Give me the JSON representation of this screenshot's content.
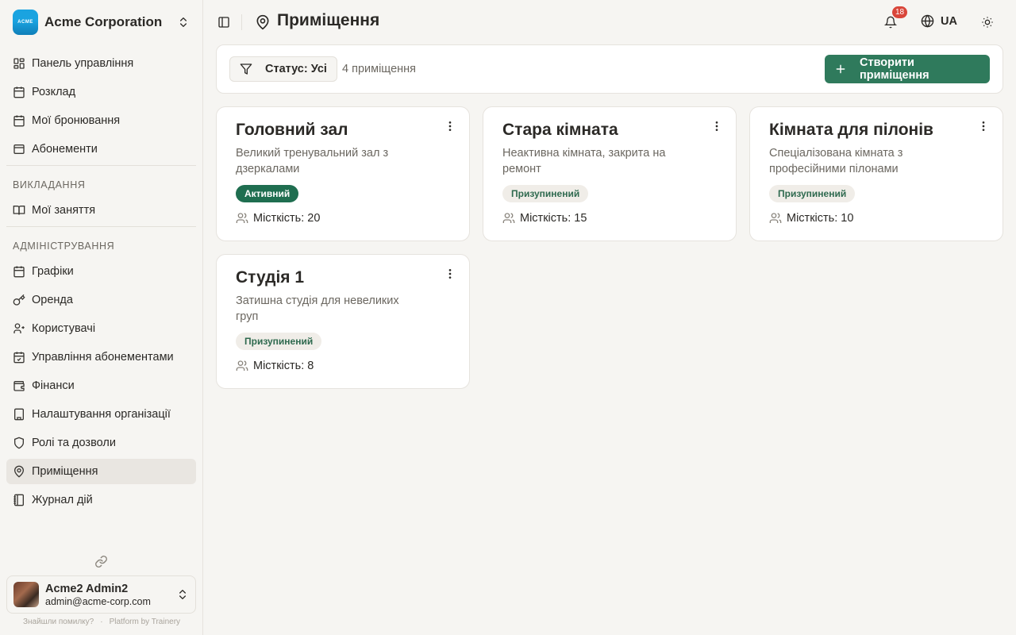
{
  "org": {
    "name": "Acme Corporation",
    "logo_text": "ACME"
  },
  "sidebar": {
    "main": [
      {
        "label": "Панель управління",
        "icon": "layout-dashboard-icon"
      },
      {
        "label": "Розклад",
        "icon": "calendar-icon"
      },
      {
        "label": "Мої бронювання",
        "icon": "calendar-check-icon"
      },
      {
        "label": "Абонементи",
        "icon": "ticket-icon"
      }
    ],
    "teaching_heading": "Викладання",
    "teaching": [
      {
        "label": "Мої заняття",
        "icon": "book-open-icon"
      }
    ],
    "admin_heading": "Адміністрування",
    "admin": [
      {
        "label": "Графіки",
        "icon": "calendar-days-icon"
      },
      {
        "label": "Оренда",
        "icon": "key-icon"
      },
      {
        "label": "Користувачі",
        "icon": "users-icon"
      },
      {
        "label": "Управління абонементами",
        "icon": "list-checks-icon"
      },
      {
        "label": "Фінанси",
        "icon": "wallet-icon"
      },
      {
        "label": "Налаштування організації",
        "icon": "building-icon"
      },
      {
        "label": "Ролі та дозволи",
        "icon": "shield-icon"
      },
      {
        "label": "Приміщення",
        "icon": "map-pin-icon"
      },
      {
        "label": "Журнал дій",
        "icon": "notebook-icon"
      }
    ]
  },
  "user": {
    "name": "Acme2 Admin2",
    "email": "admin@acme-corp.com"
  },
  "footer": {
    "report": "Знайшли помилку?",
    "separator": "·",
    "platform": "Platform by Trainery"
  },
  "header": {
    "title": "Приміщення",
    "notifications": "18",
    "language": "UA"
  },
  "toolbar": {
    "filter_label": "Статус: Усі",
    "count_label": "4 приміщення",
    "create_label": "Створити приміщення"
  },
  "rooms": [
    {
      "name": "Головний зал",
      "description": "Великий тренувальний зал з дзеркалами",
      "status": "Активний",
      "capacity": "Місткість: 20"
    },
    {
      "name": "Стара кімната",
      "description": "Неактивна кімната, закрита на ремонт",
      "status": "Призупинений",
      "capacity": "Місткість: 15"
    },
    {
      "name": "Кімната для пілонів",
      "description": "Спеціалізована кімната з професійними пілонами",
      "status": "Призупинений",
      "capacity": "Місткість: 10"
    },
    {
      "name": "Студія 1",
      "description": "Затишна студія для невеликих груп",
      "status": "Призупинений",
      "capacity": "Місткість: 8"
    }
  ],
  "colors": {
    "primary": "#2f7a5c",
    "badge_active": "#1f6e50",
    "badge_paused_bg": "#f0ede8",
    "notification": "#d9463a"
  }
}
